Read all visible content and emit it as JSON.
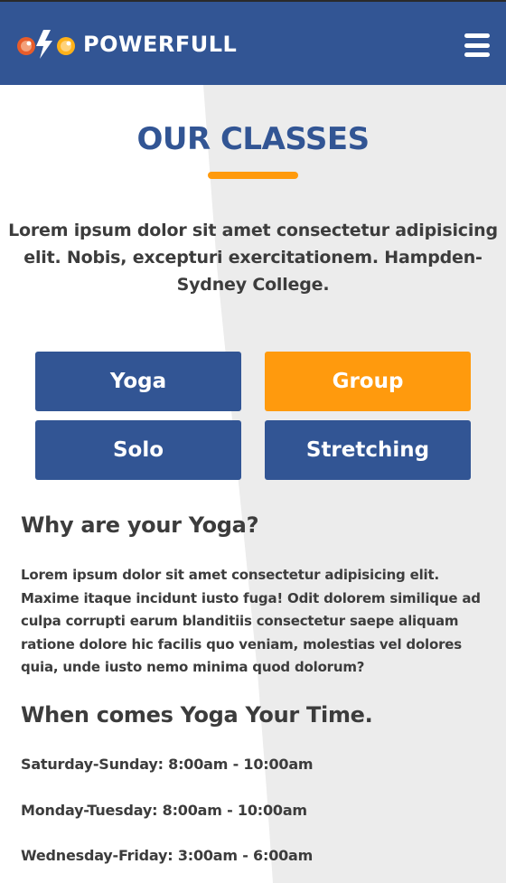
{
  "header": {
    "brand": "POWERFULL",
    "logo_icon": "powerfull-logo-icon",
    "menu_icon": "hamburger-menu-icon"
  },
  "classes": {
    "title": "OUR CLASSES",
    "intro": "Lorem ipsum dolor sit amet consectetur adipisicing elit. Nobis, excepturi exercitationem. Hampden-Sydney College.",
    "tabs": [
      {
        "label": "Yoga",
        "active": false
      },
      {
        "label": "Group",
        "active": true
      },
      {
        "label": "Solo",
        "active": false
      },
      {
        "label": "Stretching",
        "active": false
      }
    ]
  },
  "detail": {
    "why_title": "Why are your Yoga?",
    "why_text": "Lorem ipsum dolor sit amet consectetur adipisicing elit. Maxime itaque incidunt iusto fuga! Odit dolorem similique ad culpa corrupti earum blanditiis consectetur saepe aliquam ratione dolore hic facilis quo veniam, molestias vel dolores quia, unde iusto nemo minima quod dolorum?",
    "when_title": "When comes Yoga Your Time.",
    "schedule": [
      "Saturday-Sunday: 8:00am - 10:00am",
      "Monday-Tuesday: 8:00am - 10:00am",
      "Wednesday-Friday: 3:00am - 6:00am"
    ]
  },
  "colors": {
    "primary": "#325594",
    "accent": "#ff9a0d",
    "background_shade": "#ececec",
    "text": "#3c3c3c"
  }
}
